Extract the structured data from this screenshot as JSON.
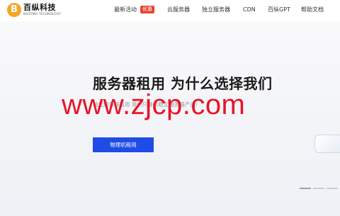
{
  "brand": {
    "mark": "B",
    "name": "百纵科技",
    "subtitle": "BAIZONG TECHNOLOGY"
  },
  "nav": {
    "items": [
      {
        "label": "最新活动"
      },
      {
        "label": "云服务器"
      },
      {
        "label": "独立服务器"
      },
      {
        "label": "CDN"
      },
      {
        "label": "百纵GPT"
      },
      {
        "label": "帮助文档"
      }
    ],
    "badge": "优惠"
  },
  "hero": {
    "title": "服务器租用 为什么选择我们",
    "subtitle": "独立服务器租用 我们只提供稳定服务器产品！",
    "cta_label": "物理机租用"
  },
  "watermark": "www.zjcp.com",
  "colors": {
    "accent": "#1f4ce6",
    "badge": "#e8422f",
    "watermark": "#e8132a",
    "logo": "#f5a623"
  }
}
